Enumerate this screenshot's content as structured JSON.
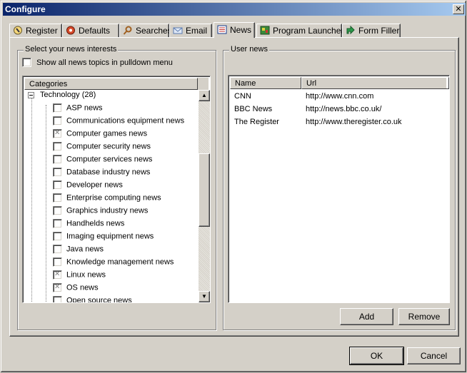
{
  "window": {
    "title": "Configure",
    "close_glyph": "✕"
  },
  "tabs": [
    {
      "label": "Register",
      "icon": "register-icon"
    },
    {
      "label": "Defaults",
      "icon": "defaults-icon"
    },
    {
      "label": "Searches",
      "icon": "searches-icon"
    },
    {
      "label": "Email",
      "icon": "email-icon"
    },
    {
      "label": "News",
      "icon": "news-icon",
      "active": true
    },
    {
      "label": "Program Launcher",
      "icon": "program-launcher-icon"
    },
    {
      "label": "Form Filler",
      "icon": "form-filler-icon"
    }
  ],
  "interests": {
    "legend": "Select your news interests",
    "show_all_label": "Show all news topics in pulldown menu",
    "show_all_checked": false,
    "categories_header": "Categories",
    "parent_label": "Technology (28)",
    "items": [
      {
        "label": "ASP news",
        "checked": false
      },
      {
        "label": "Communications equipment news",
        "checked": false
      },
      {
        "label": "Computer games news",
        "checked": true
      },
      {
        "label": "Computer security news",
        "checked": false
      },
      {
        "label": "Computer services news",
        "checked": false
      },
      {
        "label": "Database industry news",
        "checked": false
      },
      {
        "label": "Developer news",
        "checked": false
      },
      {
        "label": "Enterprise computing news",
        "checked": false
      },
      {
        "label": "Graphics industry news",
        "checked": false
      },
      {
        "label": "Handhelds news",
        "checked": false
      },
      {
        "label": "Imaging equipment news",
        "checked": false
      },
      {
        "label": "Java news",
        "checked": false
      },
      {
        "label": "Knowledge management news",
        "checked": false
      },
      {
        "label": "Linux news",
        "checked": true
      },
      {
        "label": "OS news",
        "checked": true
      },
      {
        "label": "Open source news",
        "checked": false
      }
    ]
  },
  "user_news": {
    "legend": "User news",
    "columns": [
      "Name",
      "Url"
    ],
    "rows": [
      {
        "name": "CNN",
        "url": "http://www.cnn.com"
      },
      {
        "name": "BBC News",
        "url": "http://news.bbc.co.uk/"
      },
      {
        "name": "The Register",
        "url": "http://www.theregister.co.uk"
      }
    ],
    "add_label": "Add",
    "remove_label": "Remove"
  },
  "footer": {
    "ok_label": "OK",
    "cancel_label": "Cancel"
  },
  "scroll": {
    "up_glyph": "▲",
    "down_glyph": "▼"
  }
}
